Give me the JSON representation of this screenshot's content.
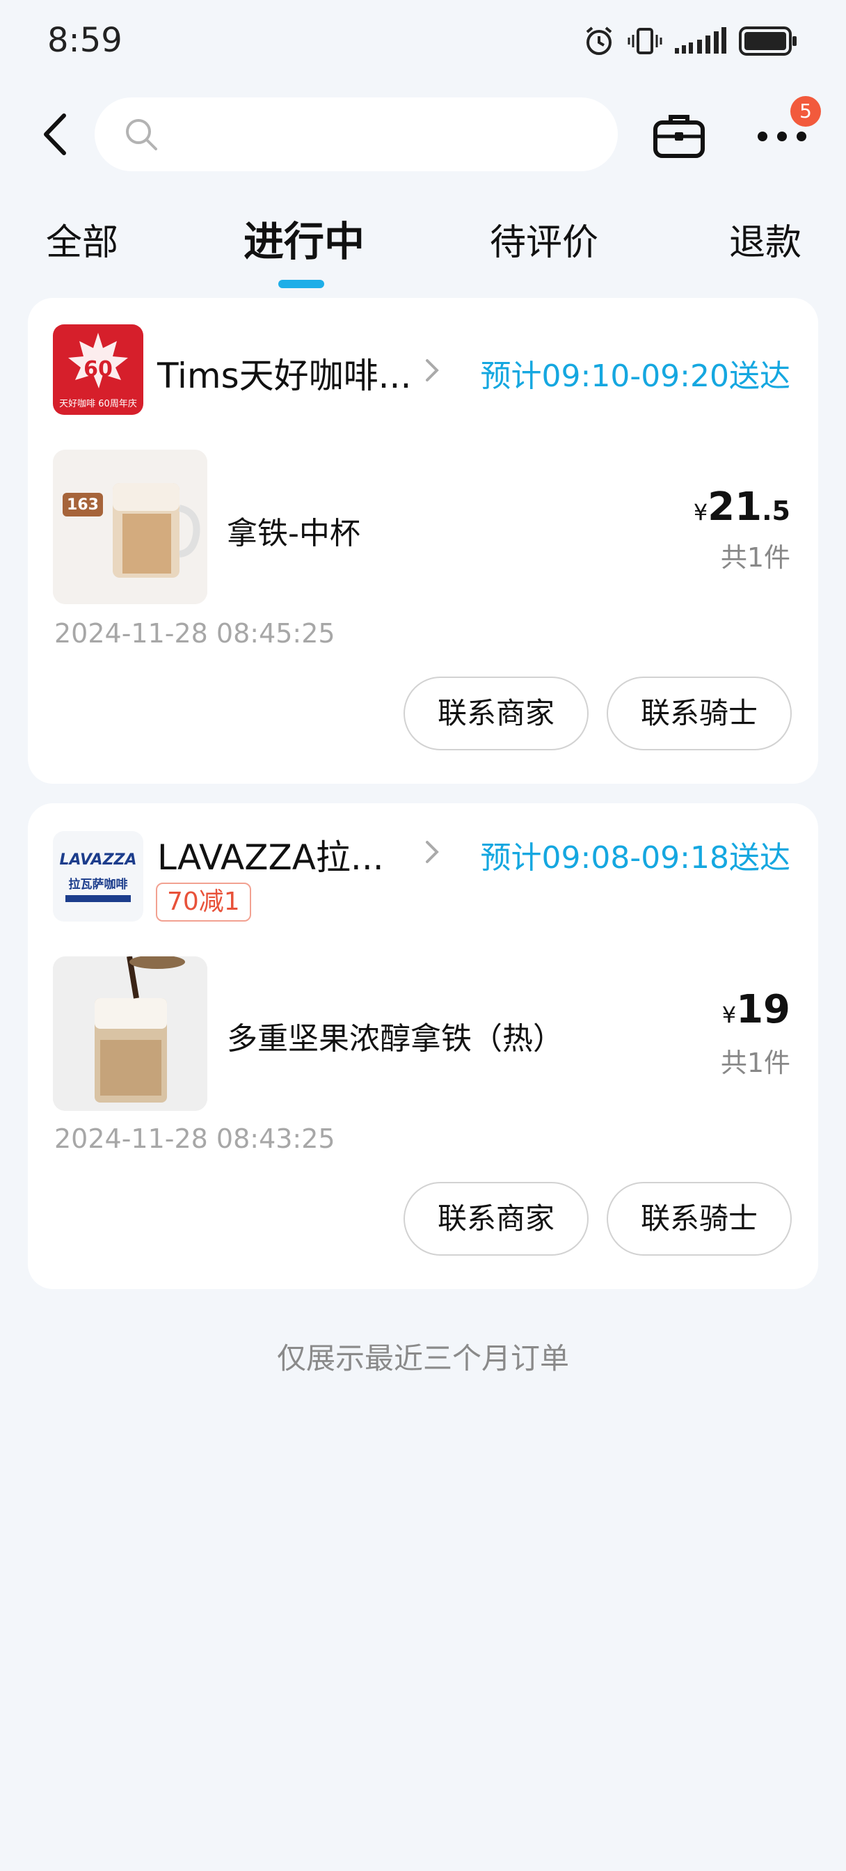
{
  "status_bar": {
    "time": "8:59"
  },
  "search": {
    "placeholder": "",
    "value": ""
  },
  "header": {
    "more_badge": "5"
  },
  "tabs": [
    {
      "label": "全部",
      "active": false
    },
    {
      "label": "进行中",
      "active": true
    },
    {
      "label": "待评价",
      "active": false
    },
    {
      "label": "退款",
      "active": false
    }
  ],
  "orders": [
    {
      "shop_name": "Tims天好咖啡...",
      "logo_text": "天好咖啡 60周年庆",
      "eta": "预计09:10-09:20送达",
      "promo": "",
      "product_name": "拿铁-中杯",
      "product_badge": "163",
      "price_symbol": "¥",
      "price_int": "21",
      "price_dec": ".5",
      "qty": "共1件",
      "order_time": "2024-11-28 08:45:25",
      "buttons": [
        "联系商家",
        "联系骑士"
      ]
    },
    {
      "shop_name": "LAVAZZA拉...",
      "logo_text": "LAVAZZA",
      "logo_sub": "拉瓦萨咖啡",
      "eta": "预计09:08-09:18送达",
      "promo": "70减1",
      "product_name": "多重坚果浓醇拿铁（热）",
      "price_symbol": "¥",
      "price_int": "19",
      "price_dec": "",
      "qty": "共1件",
      "order_time": "2024-11-28 08:43:25",
      "buttons": [
        "联系商家",
        "联系骑士"
      ]
    }
  ],
  "footer": {
    "note": "仅展示最近三个月订单"
  },
  "colors": {
    "accent": "#15a7e0",
    "badge": "#f25a3c",
    "background": "#f3f6fa",
    "promo": "#e8523a"
  }
}
